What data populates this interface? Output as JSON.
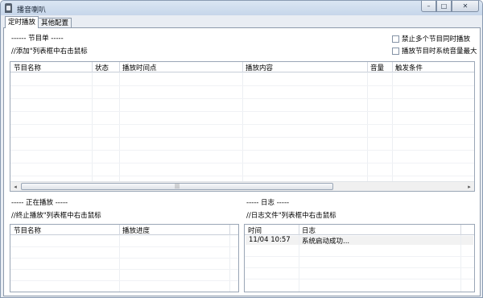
{
  "window": {
    "title": "播音喇叭",
    "min_glyph": "–",
    "max_glyph": "□",
    "close_glyph": "✕"
  },
  "tabs": [
    "定时播放",
    "其他配置"
  ],
  "playlist": {
    "section_title": "------ 节目单 -----",
    "hint": "//添加\"列表框中右击鼠标",
    "options": [
      "禁止多个节目同时播放",
      "播放节目时系统音量最大"
    ],
    "columns": [
      "节目名称",
      "状态",
      "播放时间点",
      "播放内容",
      "音量",
      "触发条件"
    ],
    "scroll_left": "◂",
    "scroll_right": "▸",
    "thumb_grip": "|||"
  },
  "now_playing": {
    "section_title": "----- 正在播放 -----",
    "hint": "//终止播放\"列表框中右击鼠标",
    "columns": [
      "节目名称",
      "播放进度"
    ]
  },
  "log": {
    "section_title": "----- 日志 -----",
    "hint": "//日志文件\"列表框中右击鼠标",
    "columns": [
      "时间",
      "日志"
    ],
    "rows": [
      {
        "time": "11/04 10:57",
        "message": "系统启动成功..."
      }
    ]
  }
}
